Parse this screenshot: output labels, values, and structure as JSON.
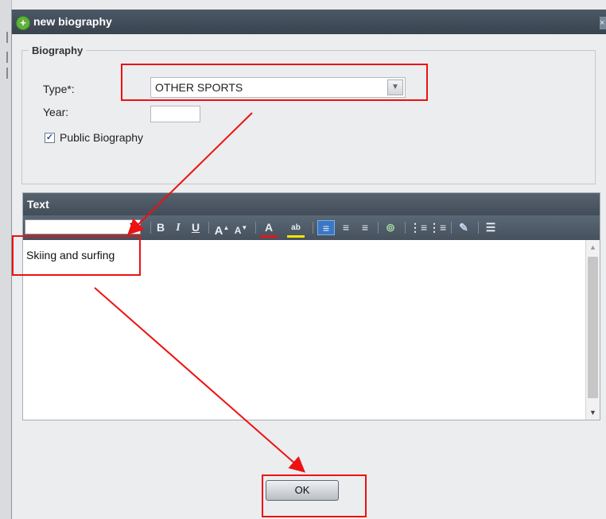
{
  "window": {
    "title": "new biography",
    "close_glyph": "×"
  },
  "biography": {
    "legend": "Biography",
    "type_label": "Type*:",
    "type_value": "OTHER SPORTS",
    "year_label": "Year:",
    "year_value": "",
    "public_label": "Public Biography",
    "public_checked": true
  },
  "text_section": {
    "header": "Text",
    "font_select_value": "",
    "toolbar": [
      {
        "icon": "bold-icon",
        "glyph": "B"
      },
      {
        "icon": "italic-icon",
        "glyph": "I"
      },
      {
        "icon": "underline-icon",
        "glyph": "U"
      },
      {
        "icon": "increase-font-size-icon",
        "glyph": "A"
      },
      {
        "icon": "decrease-font-size-icon",
        "glyph": "A"
      },
      {
        "icon": "font-color-icon",
        "glyph": "A"
      },
      {
        "icon": "highlight-color-icon",
        "glyph": "ab"
      },
      {
        "icon": "align-left-icon",
        "glyph": "≡",
        "selected": true
      },
      {
        "icon": "align-center-icon",
        "glyph": "≡"
      },
      {
        "icon": "align-right-icon",
        "glyph": "≡"
      },
      {
        "icon": "insert-link-icon",
        "glyph": "⊚"
      },
      {
        "icon": "numbered-list-icon",
        "glyph": "⋮≡"
      },
      {
        "icon": "bullet-list-icon",
        "glyph": "⋮≡"
      },
      {
        "icon": "edit-source-icon",
        "glyph": "✎"
      },
      {
        "icon": "source-edit-icon",
        "glyph": "☰"
      }
    ],
    "content": "Skiing and surfing"
  },
  "ok_label": "OK",
  "colors": {
    "title_bar": "#434e5b",
    "highlight": "#ee1111",
    "font_color_underline": "#e01818",
    "highlight_underline": "#f2e600"
  }
}
